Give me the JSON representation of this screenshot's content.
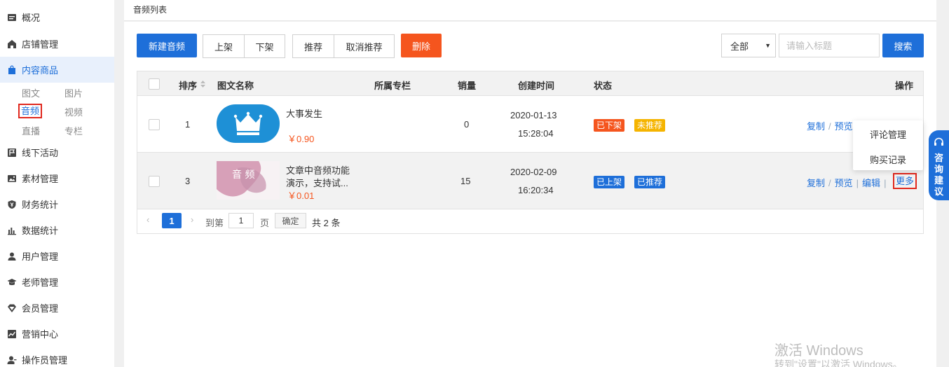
{
  "sidebar": {
    "items": [
      {
        "label": "概况",
        "icon": "overview-icon"
      },
      {
        "label": "店铺管理",
        "icon": "store-icon"
      },
      {
        "label": "内容商品",
        "icon": "bag-icon"
      },
      {
        "label": "线下活动",
        "icon": "flag-icon"
      },
      {
        "label": "素材管理",
        "icon": "image-icon"
      },
      {
        "label": "财务统计",
        "icon": "yen-shield-icon"
      },
      {
        "label": "数据统计",
        "icon": "bar-chart-icon"
      },
      {
        "label": "用户管理",
        "icon": "user-icon"
      },
      {
        "label": "老师管理",
        "icon": "graduation-cap-icon"
      },
      {
        "label": "会员管理",
        "icon": "diamond-icon"
      },
      {
        "label": "营销中心",
        "icon": "line-chart-icon"
      },
      {
        "label": "操作员管理",
        "icon": "operator-icon"
      }
    ],
    "sub": [
      "图文",
      "图片",
      "音频",
      "视频",
      "直播",
      "专栏"
    ]
  },
  "header": {
    "breadcrumb": "音频列表"
  },
  "toolbar": {
    "new_label": "新建音频",
    "shelve_label": "上架",
    "unshelve_label": "下架",
    "recommend_label": "推荐",
    "unrecommend_label": "取消推荐",
    "delete_label": "删除",
    "filter_value": "全部",
    "search_placeholder": "请输入标题",
    "search_label": "搜索"
  },
  "table": {
    "headers": {
      "sort": "排序",
      "name": "图文名称",
      "column": "所属专栏",
      "sales": "销量",
      "created": "创建时间",
      "status": "状态",
      "actions": "操作"
    },
    "rows": [
      {
        "sort": "1",
        "title": "大事发生",
        "price": "￥0.90",
        "sales": "0",
        "date": "2020-01-13",
        "time": "15:28:04",
        "status1": "已下架",
        "status2": "未推荐"
      },
      {
        "sort": "3",
        "title": "文章中音频功能",
        "title2": "演示，支持试...",
        "price": "￥0.01",
        "sales": "15",
        "date": "2020-02-09",
        "time": "16:20:34",
        "status1": "已上架",
        "status2": "已推荐",
        "thumb_text": "音 频"
      }
    ],
    "actions": {
      "copy": "复制",
      "preview": "预览",
      "edit": "编辑",
      "more": "更多",
      "divider": "/",
      "bar": "|"
    }
  },
  "dropdown": {
    "comments": "评论管理",
    "purchases": "购买记录"
  },
  "pagination": {
    "current": "1",
    "goto_prefix": "到第",
    "goto_value": "1",
    "goto_suffix": "页",
    "confirm": "确定",
    "total": "共 2 条",
    "prev": "‹",
    "next": "›"
  },
  "consult": {
    "label": "咨询建议"
  },
  "watermark": {
    "line1": "激活 Windows",
    "line2": "转到\"设置\"以激活 Windows。"
  },
  "colors": {
    "primary": "#1e6fd9",
    "danger": "#f5551e",
    "warning": "#f5b400"
  }
}
